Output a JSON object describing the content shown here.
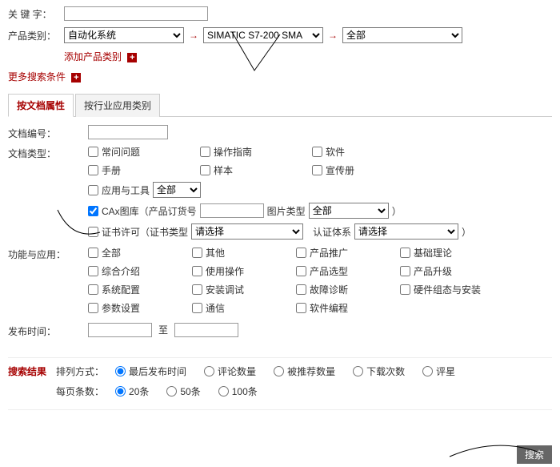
{
  "keyword": {
    "label": "关 键 字：",
    "value": ""
  },
  "category": {
    "label": "产品类别：",
    "level1": "自动化系统",
    "level2": "SIMATIC S7-200 SMA",
    "level3": "全部",
    "add_label": "添加产品类别",
    "add_icon": "+"
  },
  "more_label": "更多搜索条件",
  "tabs": [
    "按文档属性",
    "按行业应用类别"
  ],
  "doc_id": {
    "label": "文档编号：",
    "value": ""
  },
  "doc_type": {
    "label": "文档类型：",
    "items": [
      "常问问题",
      "操作指南",
      "软件",
      "手册",
      "样本",
      "宣传册"
    ],
    "app_tool": "应用与工具",
    "app_tool_sel": "全部",
    "cax": {
      "label": "CAx图库（产品订货号",
      "val": "",
      "img_type_label": "图片类型",
      "img_type_sel": "全部",
      "close": "）"
    },
    "cert": {
      "label": "证书许可（证书类型",
      "type_sel": "请选择",
      "sys_label": "认证体系",
      "sys_sel": "请选择",
      "close": "）"
    }
  },
  "func": {
    "label": "功能与应用：",
    "items": [
      "全部",
      "其他",
      "产品推广",
      "基础理论",
      "综合介绍",
      "使用操作",
      "产品选型",
      "产品升级",
      "系统配置",
      "安装调试",
      "故障诊断",
      "硬件组态与安装",
      "参数设置",
      "通信",
      "软件编程"
    ]
  },
  "pub": {
    "label": "发布时间：",
    "from": "",
    "to_label": "至",
    "to": ""
  },
  "results": {
    "title": "搜索结果",
    "sort_label": "排列方式：",
    "sort_opts": [
      "最后发布时间",
      "评论数量",
      "被推荐数量",
      "下载次数",
      "评星"
    ],
    "per_label": "每页条数：",
    "per_opts": [
      "20条",
      "50条",
      "100条"
    ]
  },
  "search_btn": "搜索"
}
